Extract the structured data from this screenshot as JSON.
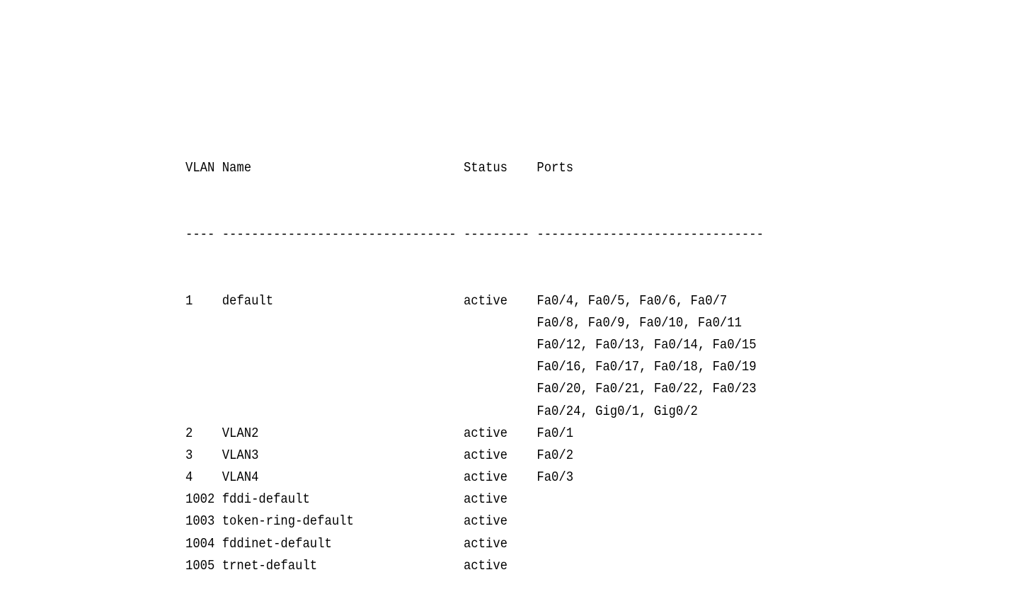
{
  "header": {
    "vlan": "VLAN",
    "name": "Name",
    "status": "Status",
    "ports": "Ports"
  },
  "separator": {
    "vlan": "----",
    "name": "--------------------------------",
    "status": "---------",
    "ports": "-------------------------------"
  },
  "rows": [
    {
      "vlan": "1",
      "name": "default",
      "status": "active",
      "ports": [
        "Fa0/4, Fa0/5, Fa0/6, Fa0/7",
        "Fa0/8, Fa0/9, Fa0/10, Fa0/11",
        "Fa0/12, Fa0/13, Fa0/14, Fa0/15",
        "Fa0/16, Fa0/17, Fa0/18, Fa0/19",
        "Fa0/20, Fa0/21, Fa0/22, Fa0/23",
        "Fa0/24, Gig0/1, Gig0/2"
      ]
    },
    {
      "vlan": "2",
      "name": "VLAN2",
      "status": "active",
      "ports": [
        "Fa0/1"
      ]
    },
    {
      "vlan": "3",
      "name": "VLAN3",
      "status": "active",
      "ports": [
        "Fa0/2"
      ]
    },
    {
      "vlan": "4",
      "name": "VLAN4",
      "status": "active",
      "ports": [
        "Fa0/3"
      ]
    },
    {
      "vlan": "1002",
      "name": "fddi-default",
      "status": "active",
      "ports": []
    },
    {
      "vlan": "1003",
      "name": "token-ring-default",
      "status": "active",
      "ports": []
    },
    {
      "vlan": "1004",
      "name": "fddinet-default",
      "status": "active",
      "ports": []
    },
    {
      "vlan": "1005",
      "name": "trnet-default",
      "status": "active",
      "ports": []
    }
  ]
}
